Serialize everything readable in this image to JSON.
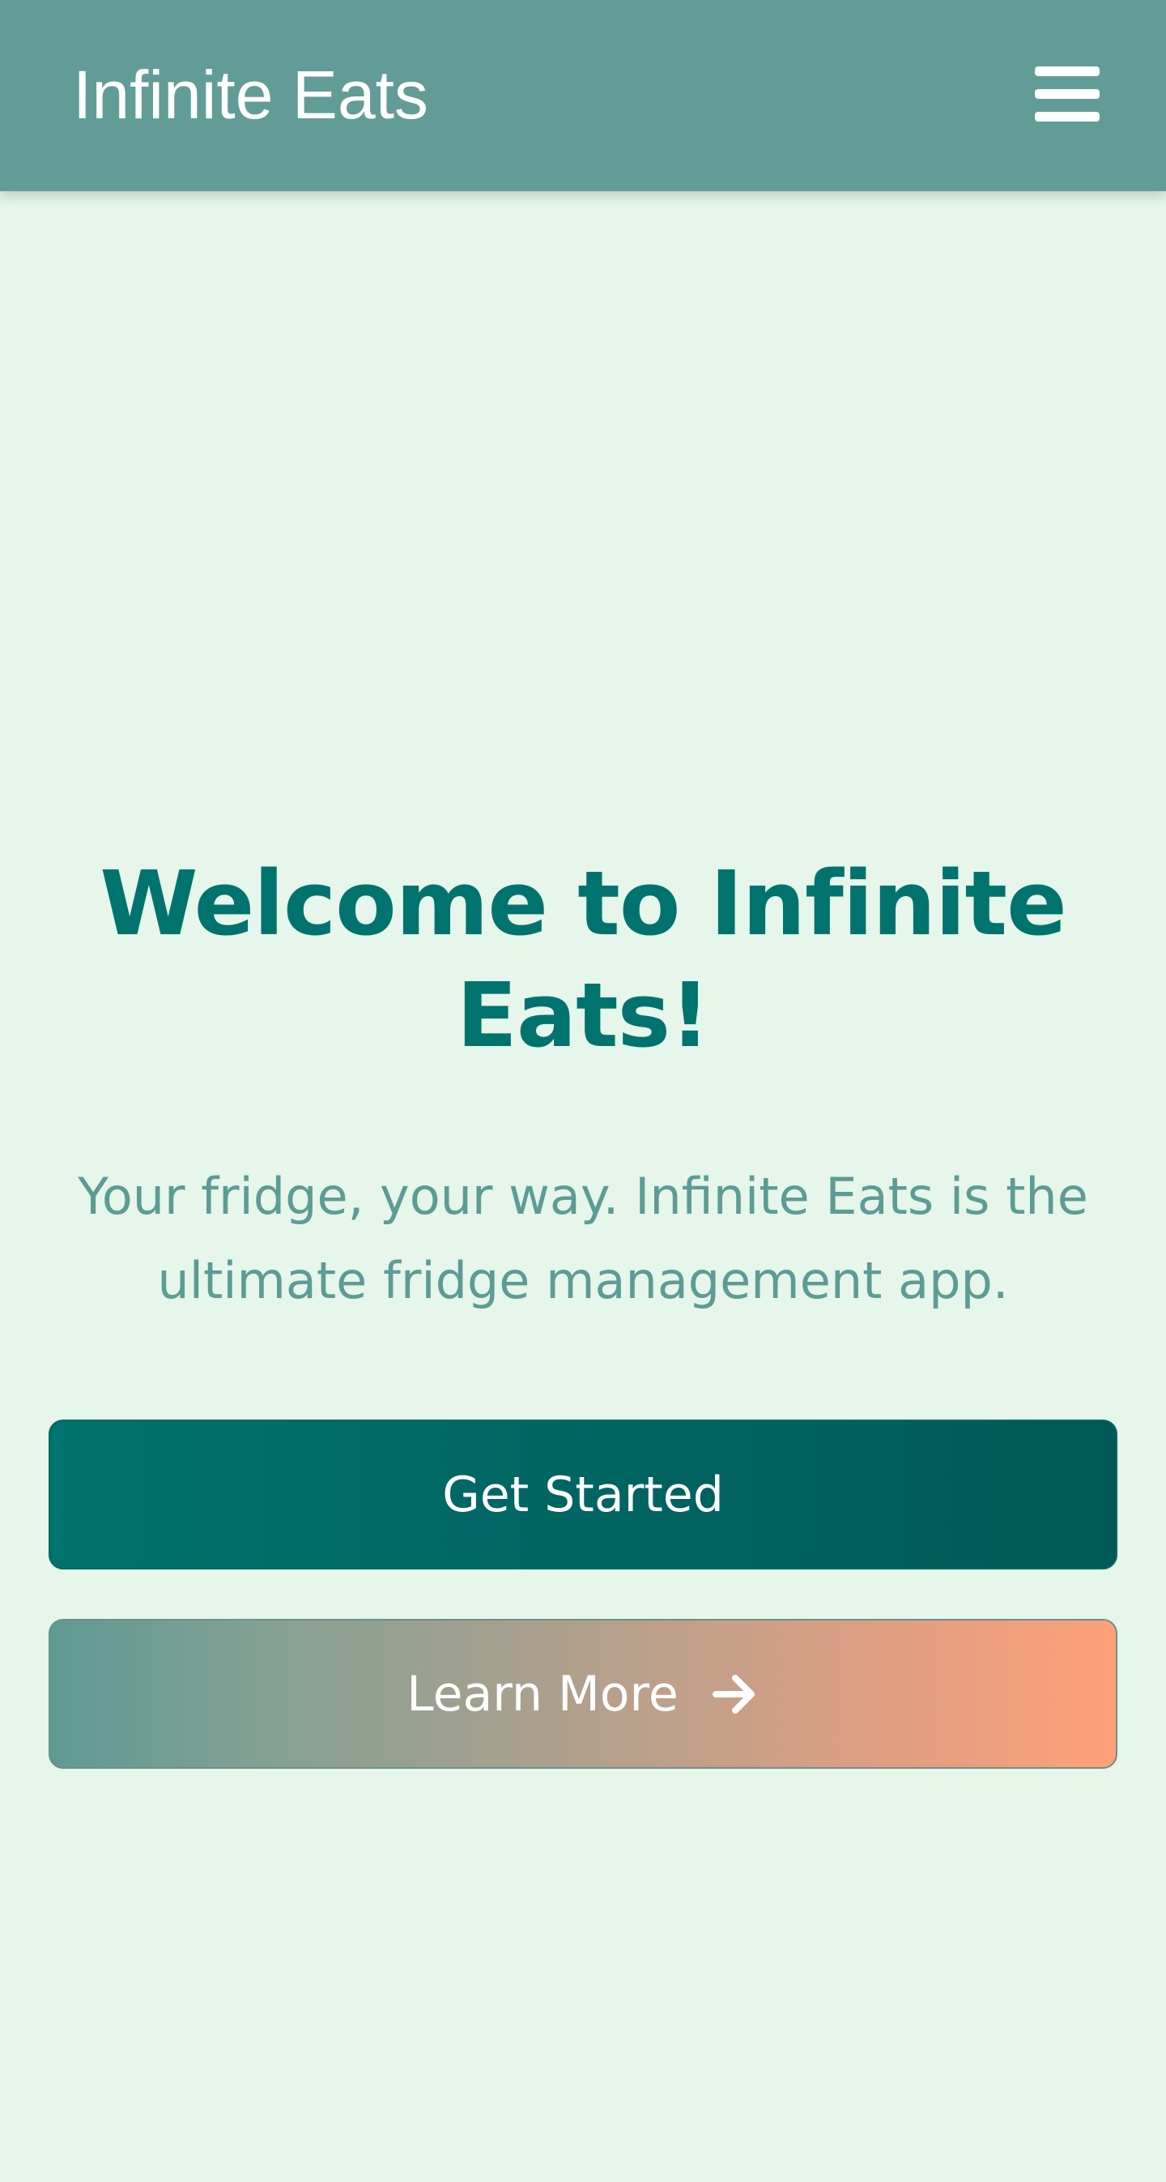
{
  "header": {
    "brand": "Infinite Eats",
    "menu_icon": "hamburger-menu-icon"
  },
  "hero": {
    "title": "Welcome to Infinite Eats!",
    "subtitle": "Your fridge, your way. Infinite Eats is the ultimate fridge management app.",
    "primary_button_label": "Get Started",
    "secondary_button_label": "Learn More",
    "secondary_button_icon": "arrow-right-icon"
  },
  "colors": {
    "background": "#e6f6ea",
    "header": "#619d96",
    "title": "#00736e",
    "subtitle": "#5d9c95",
    "primary_button": "#00736e",
    "secondary_button_start": "#5f9a95",
    "secondary_button_end": "#ffa07a"
  }
}
